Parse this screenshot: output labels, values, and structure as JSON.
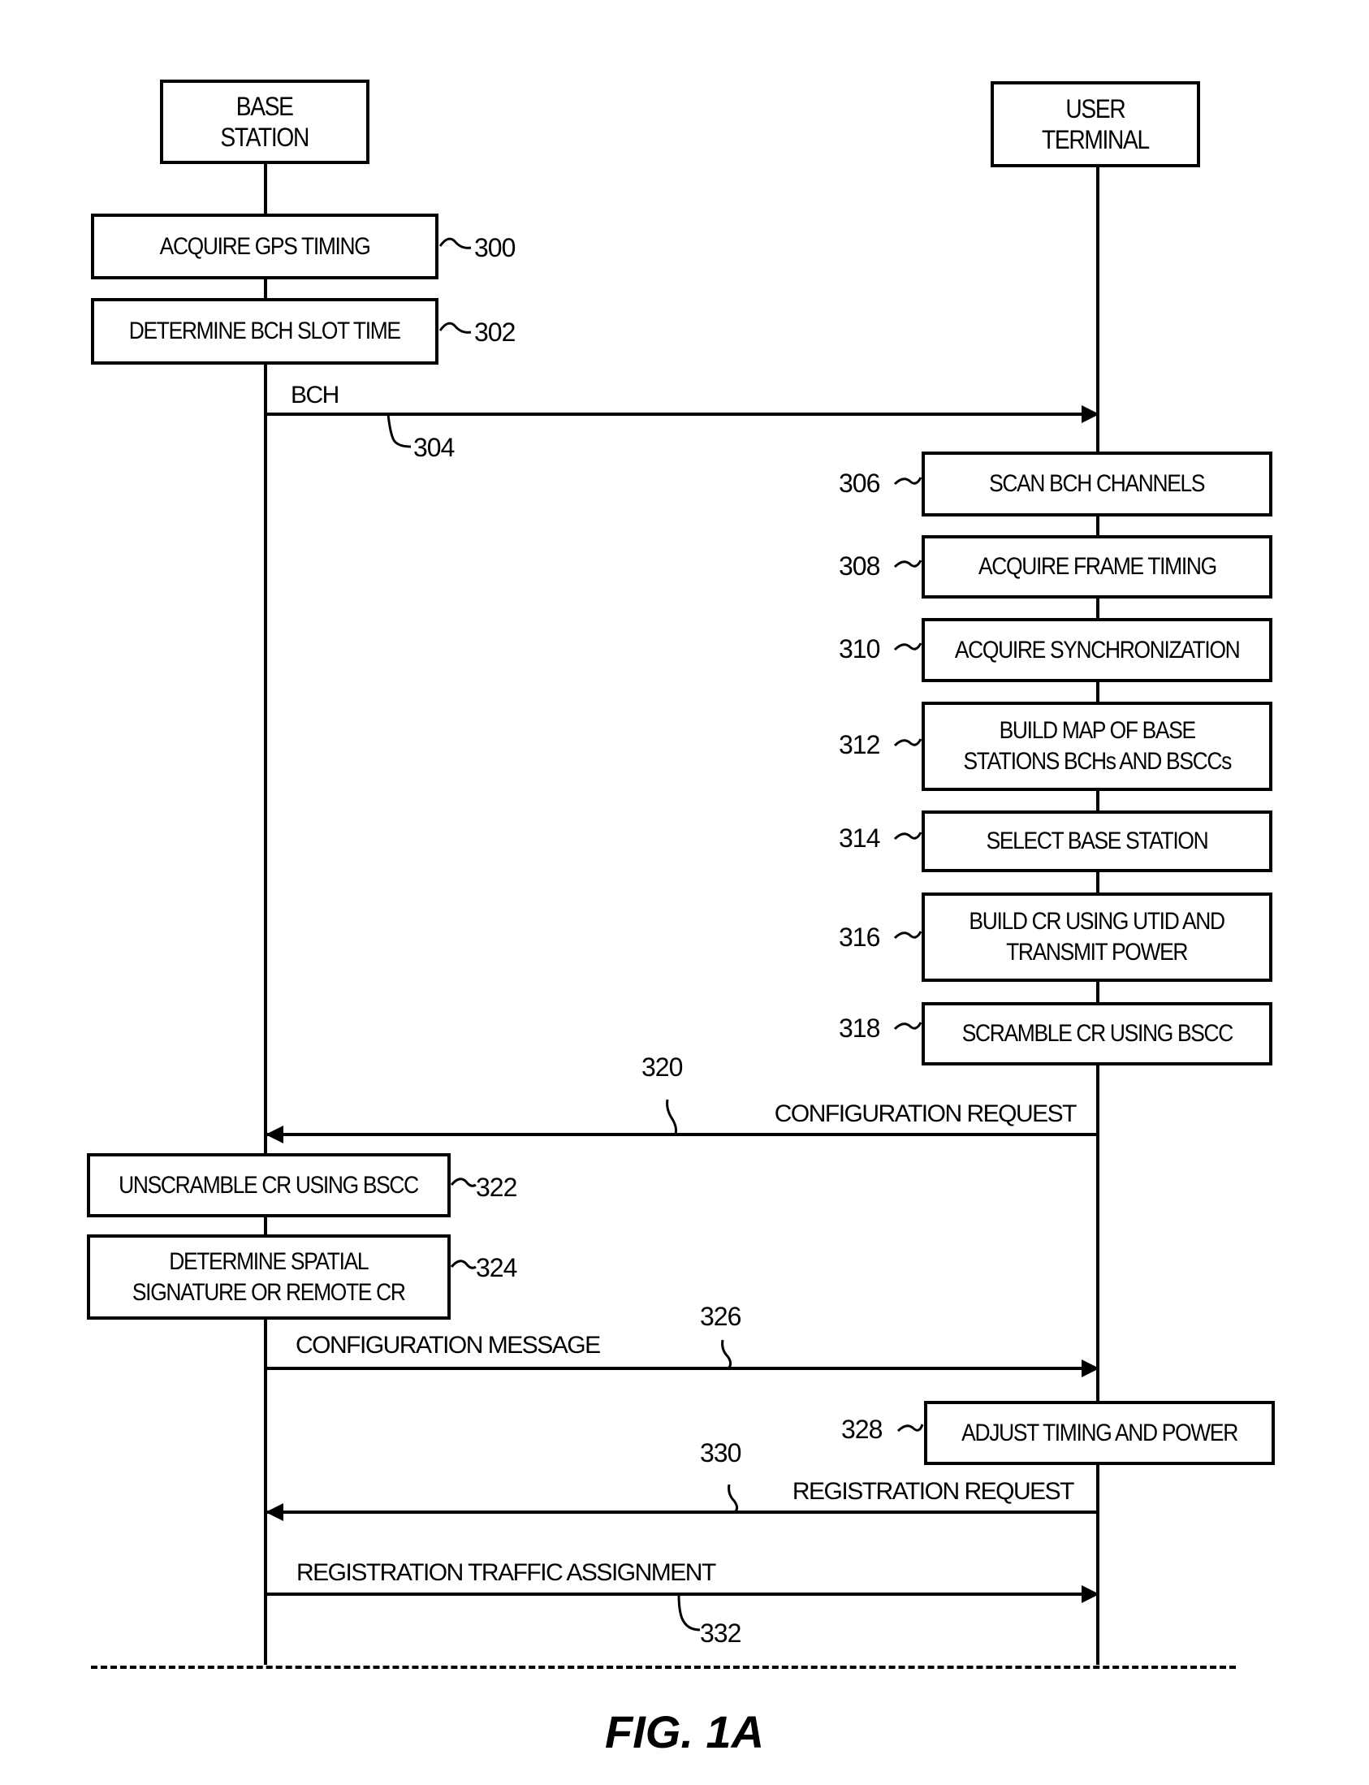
{
  "figure": {
    "caption": "FIG. 1A",
    "actors": {
      "base_station": "BASE\nSTATION",
      "user_terminal": "USER\nTERMINAL"
    },
    "base_station_steps": [
      {
        "ref": "300",
        "label": "ACQUIRE GPS TIMING"
      },
      {
        "ref": "302",
        "label": "DETERMINE BCH SLOT TIME"
      },
      {
        "ref": "322",
        "label": "UNSCRAMBLE CR USING BSCC"
      },
      {
        "ref": "324",
        "label": "DETERMINE SPATIAL\nSIGNATURE OR REMOTE CR"
      }
    ],
    "user_terminal_steps": [
      {
        "ref": "306",
        "label": "SCAN BCH CHANNELS"
      },
      {
        "ref": "308",
        "label": "ACQUIRE FRAME TIMING"
      },
      {
        "ref": "310",
        "label": "ACQUIRE SYNCHRONIZATION"
      },
      {
        "ref": "312",
        "label": "BUILD MAP OF BASE\nSTATIONS BCHs AND BSCCs"
      },
      {
        "ref": "314",
        "label": "SELECT BASE STATION"
      },
      {
        "ref": "316",
        "label": "BUILD CR USING UTID AND\nTRANSMIT POWER"
      },
      {
        "ref": "318",
        "label": "SCRAMBLE CR USING BSCC"
      },
      {
        "ref": "328",
        "label": "ADJUST TIMING AND POWER"
      }
    ],
    "messages": [
      {
        "ref": "304",
        "label": "BCH",
        "direction": "base-to-terminal"
      },
      {
        "ref": "320",
        "label": "CONFIGURATION REQUEST",
        "direction": "terminal-to-base"
      },
      {
        "ref": "326",
        "label": "CONFIGURATION MESSAGE",
        "direction": "base-to-terminal"
      },
      {
        "ref": "330",
        "label": "REGISTRATION REQUEST",
        "direction": "terminal-to-base"
      },
      {
        "ref": "332",
        "label": "REGISTRATION TRAFFIC ASSIGNMENT",
        "direction": "base-to-terminal"
      }
    ]
  }
}
